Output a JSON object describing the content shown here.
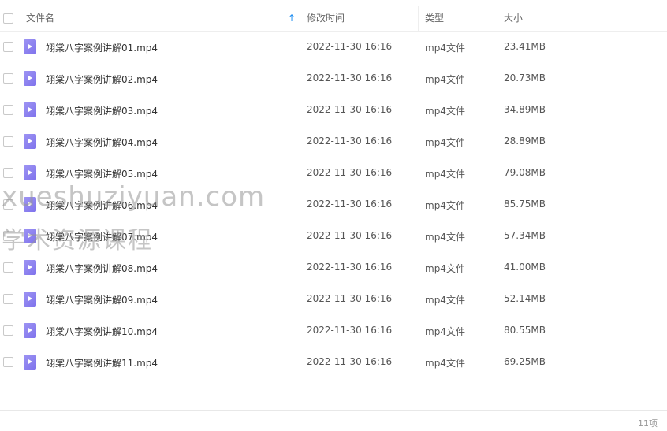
{
  "header": {
    "name": "文件名",
    "sort_icon": "↑",
    "mtime": "修改时间",
    "type": "类型",
    "size": "大小"
  },
  "files": [
    {
      "name": "翊棠八字案例讲解01.mp4",
      "mtime": "2022-11-30 16:16",
      "type": "mp4文件",
      "size": "23.41MB"
    },
    {
      "name": "翊棠八字案例讲解02.mp4",
      "mtime": "2022-11-30 16:16",
      "type": "mp4文件",
      "size": "20.73MB"
    },
    {
      "name": "翊棠八字案例讲解03.mp4",
      "mtime": "2022-11-30 16:16",
      "type": "mp4文件",
      "size": "34.89MB"
    },
    {
      "name": "翊棠八字案例讲解04.mp4",
      "mtime": "2022-11-30 16:16",
      "type": "mp4文件",
      "size": "28.89MB"
    },
    {
      "name": "翊棠八字案例讲解05.mp4",
      "mtime": "2022-11-30 16:16",
      "type": "mp4文件",
      "size": "79.08MB"
    },
    {
      "name": "翊棠八字案例讲解06.mp4",
      "mtime": "2022-11-30 16:16",
      "type": "mp4文件",
      "size": "85.75MB"
    },
    {
      "name": "翊棠八字案例讲解07.mp4",
      "mtime": "2022-11-30 16:16",
      "type": "mp4文件",
      "size": "57.34MB"
    },
    {
      "name": "翊棠八字案例讲解08.mp4",
      "mtime": "2022-11-30 16:16",
      "type": "mp4文件",
      "size": "41.00MB"
    },
    {
      "name": "翊棠八字案例讲解09.mp4",
      "mtime": "2022-11-30 16:16",
      "type": "mp4文件",
      "size": "52.14MB"
    },
    {
      "name": "翊棠八字案例讲解10.mp4",
      "mtime": "2022-11-30 16:16",
      "type": "mp4文件",
      "size": "80.55MB"
    },
    {
      "name": "翊棠八字案例讲解11.mp4",
      "mtime": "2022-11-30 16:16",
      "type": "mp4文件",
      "size": "69.25MB"
    }
  ],
  "footer": {
    "count": "11项"
  },
  "watermark": {
    "line1": "xueshuziyuan.com",
    "line2": "学术资源课程"
  },
  "colors": {
    "file_icon": "#8a7ff0",
    "sort_accent": "#1f8ef1"
  }
}
